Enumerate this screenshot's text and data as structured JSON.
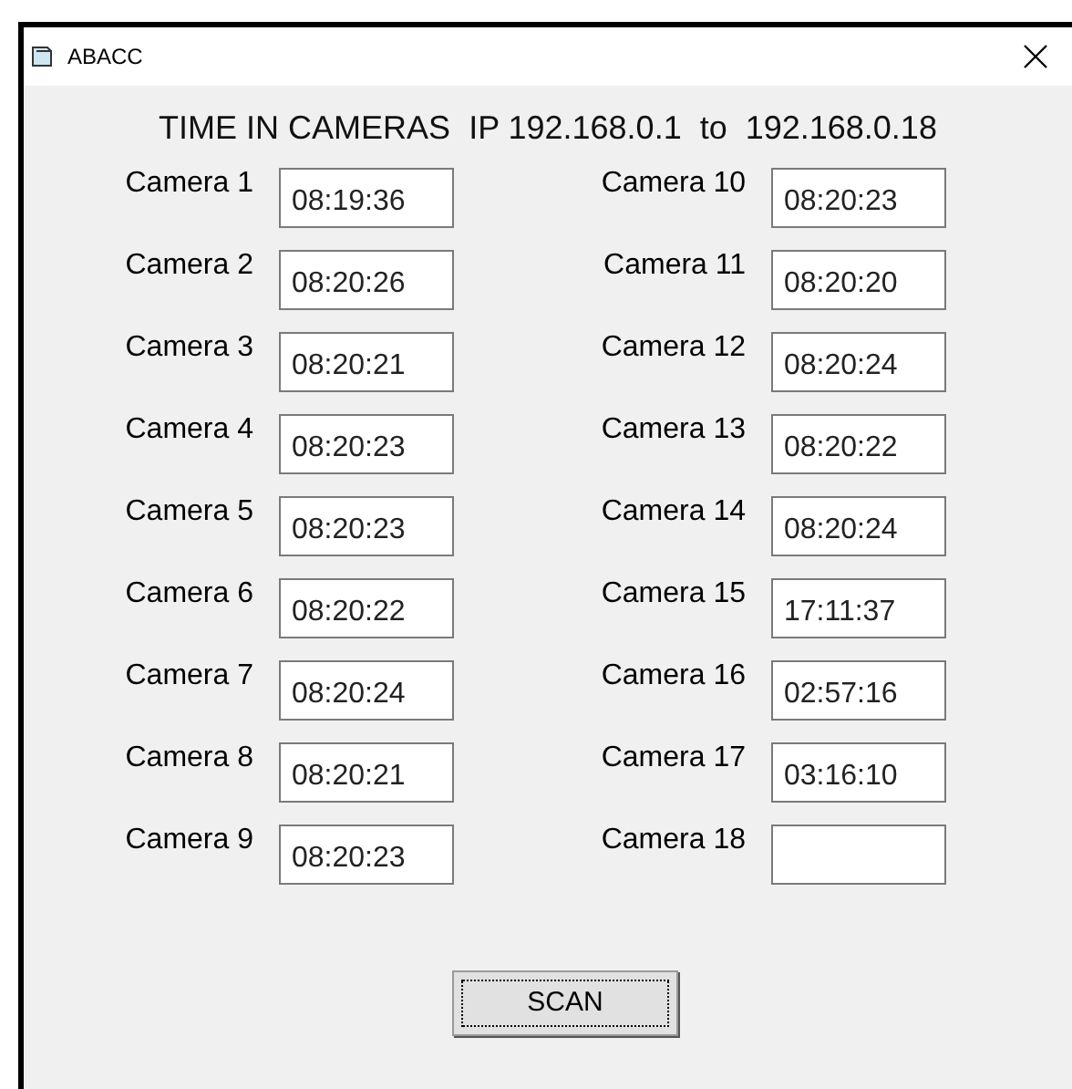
{
  "window": {
    "title": "ABACC"
  },
  "heading": "TIME IN CAMERAS  IP 192.168.0.1  to  192.168.0.18",
  "cameras": [
    {
      "label": "Camera 1",
      "value": "08:19:36"
    },
    {
      "label": "Camera 2",
      "value": "08:20:26"
    },
    {
      "label": "Camera 3",
      "value": "08:20:21"
    },
    {
      "label": "Camera 4",
      "value": "08:20:23"
    },
    {
      "label": "Camera 5",
      "value": "08:20:23"
    },
    {
      "label": "Camera 6",
      "value": "08:20:22"
    },
    {
      "label": "Camera 7",
      "value": "08:20:24"
    },
    {
      "label": "Camera 8",
      "value": "08:20:21"
    },
    {
      "label": "Camera 9",
      "value": "08:20:23"
    },
    {
      "label": "Camera 10",
      "value": "08:20:23"
    },
    {
      "label": "Camera 11",
      "value": "08:20:20"
    },
    {
      "label": "Camera 12",
      "value": "08:20:24"
    },
    {
      "label": "Camera 13",
      "value": "08:20:22"
    },
    {
      "label": "Camera 14",
      "value": "08:20:24"
    },
    {
      "label": "Camera 15",
      "value": "17:11:37"
    },
    {
      "label": "Camera 16",
      "value": "02:57:16"
    },
    {
      "label": "Camera 17",
      "value": "03:16:10"
    },
    {
      "label": "Camera 18"
    }
  ],
  "button": "SCAN"
}
